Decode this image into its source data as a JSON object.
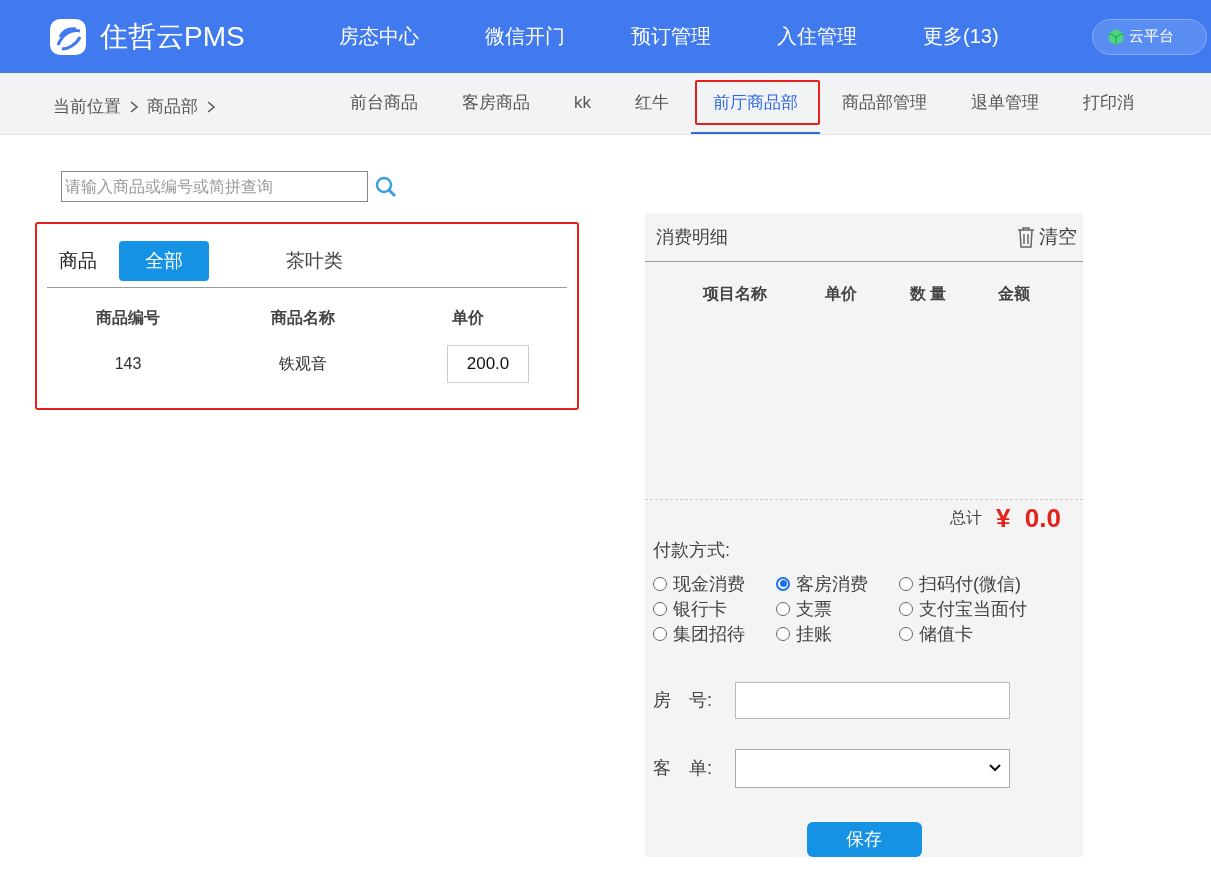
{
  "header": {
    "brand": "住哲云PMS",
    "nav": [
      {
        "label": "房态中心"
      },
      {
        "label": "微信开门"
      },
      {
        "label": "预订管理"
      },
      {
        "label": "入住管理"
      },
      {
        "label": "更多(13)"
      }
    ],
    "platform_button": "云平台"
  },
  "subnav": {
    "breadcrumb": [
      "当前位置",
      "商品部"
    ],
    "tabs": [
      {
        "label": "前台商品",
        "selected": false,
        "highlighted": false
      },
      {
        "label": "客房商品",
        "selected": false,
        "highlighted": false
      },
      {
        "label": "kk",
        "selected": false,
        "highlighted": false
      },
      {
        "label": "红牛",
        "selected": false,
        "highlighted": false
      },
      {
        "label": "前厅商品部",
        "selected": true,
        "highlighted": true
      },
      {
        "label": "商品部管理",
        "selected": false,
        "highlighted": false
      },
      {
        "label": "退单管理",
        "selected": false,
        "highlighted": false
      },
      {
        "label": "打印消",
        "selected": false,
        "highlighted": false
      }
    ]
  },
  "search": {
    "placeholder": "请输入商品或编号或简拼查询"
  },
  "goods": {
    "highlighted": true,
    "label": "商品",
    "categories": [
      {
        "label": "全部",
        "selected": true
      },
      {
        "label": "茶叶类",
        "selected": false
      }
    ],
    "columns": [
      "商品编号",
      "商品名称",
      "单价"
    ],
    "rows": [
      {
        "code": "143",
        "name": "铁观音",
        "price": "200.0"
      }
    ]
  },
  "detail": {
    "title": "消费明细",
    "clear": "清空",
    "columns": [
      "项目名称",
      "单价",
      "数 量",
      "金额"
    ],
    "total_label": "总计",
    "total": "¥  0.0",
    "payment_label": "付款方式:",
    "payment_methods": [
      {
        "label": "现金消费",
        "selected": false
      },
      {
        "label": "客房消费",
        "selected": true
      },
      {
        "label": "扫码付(微信)",
        "selected": false
      },
      {
        "label": "银行卡",
        "selected": false
      },
      {
        "label": "支票",
        "selected": false
      },
      {
        "label": "支付宝当面付",
        "selected": false
      },
      {
        "label": "集团招待",
        "selected": false
      },
      {
        "label": "挂账",
        "selected": false
      },
      {
        "label": "储值卡",
        "selected": false
      }
    ],
    "room_label": "房　号:",
    "order_label": "客　单:",
    "save": "保存"
  }
}
